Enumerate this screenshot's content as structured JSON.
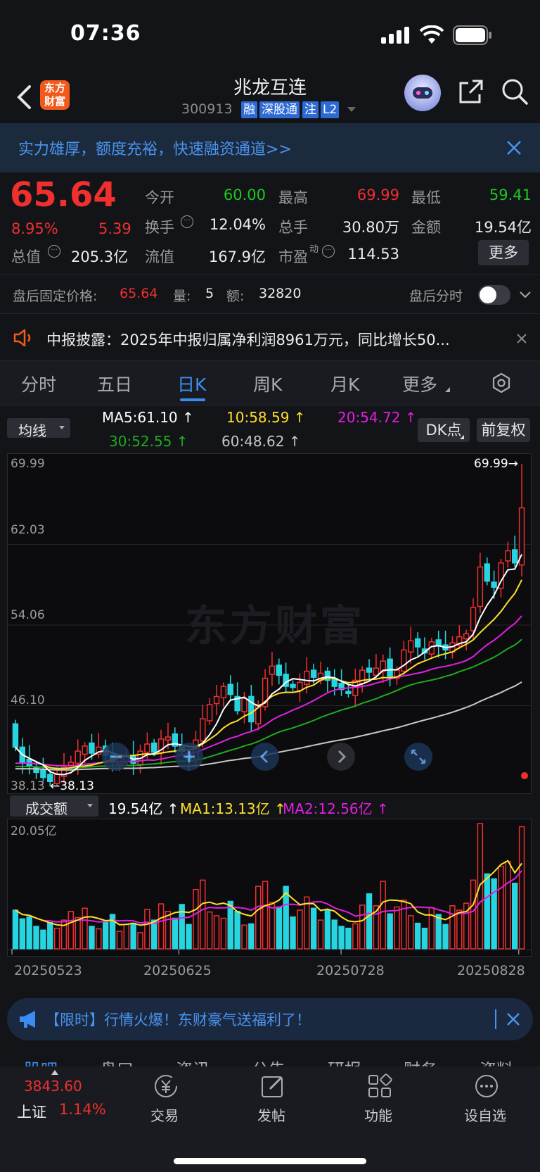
{
  "status": {
    "time": "07:36"
  },
  "header": {
    "logo_text": "东方财富",
    "stock_name": "兆龙互连",
    "stock_code": "300913",
    "tags": [
      "融",
      "深股通",
      "注",
      "L2"
    ]
  },
  "banner": {
    "text": "实力雄厚，额度充裕，快速融资通道>>"
  },
  "quote": {
    "price": "65.64",
    "change_pct": "8.95%",
    "change": "5.39",
    "open_label": "今开",
    "open": "60.00",
    "high_label": "最高",
    "high": "69.99",
    "low_label": "最低",
    "low": "59.41",
    "turnover_label": "换手",
    "turnover": "12.04%",
    "volume_label": "总手",
    "volume": "30.80万",
    "amount_label": "金额",
    "amount": "19.54亿",
    "mktcap_label": "总值",
    "mktcap": "205.3亿",
    "float_label": "流值",
    "float": "167.9亿",
    "pe_label": "市盈",
    "pe_sup": "动",
    "pe": "114.53",
    "more_label": "更多"
  },
  "afterhours": {
    "label": "盘后固定价格:",
    "price": "65.64",
    "vol_label": "量:",
    "vol": "5",
    "amt_label": "额:",
    "amt": "32820",
    "toggle_label": "盘后分时"
  },
  "notice": {
    "text": "中报披露：2025年中报归属净利润8961万元，同比增长50..."
  },
  "tabs": [
    "分时",
    "五日",
    "日K",
    "周K",
    "月K",
    "更多"
  ],
  "active_tab": "日K",
  "ma": {
    "selector": "均线",
    "ma5": "MA5:61.10",
    "ma10": "10:58.59",
    "ma20": "20:54.72",
    "ma30": "30:52.55",
    "ma60": "60:48.62",
    "dk_label": "DK点",
    "adjust_label": "前复权"
  },
  "chart_labels": {
    "y_ticks": [
      "69.99",
      "62.03",
      "54.06",
      "46.10",
      "38.13"
    ],
    "max_marker": "69.99→",
    "min_marker": "←38.13",
    "watermark": "东方财富"
  },
  "volume_header": {
    "selector": "成交额",
    "value": "19.54亿",
    "ma1": "MA1:13.13亿",
    "ma2": "MA2:12.56亿",
    "max_tick": "20.05亿"
  },
  "dates": [
    "20250523",
    "20250625",
    "20250728",
    "20250828"
  ],
  "promo": {
    "text": "【限时】行情火爆！东财豪气送福利了！"
  },
  "bottom_tabs": [
    "股吧",
    "盘口",
    "资讯",
    "公告",
    "研报",
    "财务",
    "资料"
  ],
  "bottombar": {
    "index_value": "3843.60",
    "index_name": "上证",
    "index_change": "1.14%",
    "items": [
      "交易",
      "发帖",
      "功能",
      "设自选"
    ]
  },
  "colors": {
    "up": "#f02f2f",
    "down": "#27d5e0",
    "ma5": "#ffffff",
    "ma10": "#ffe02a",
    "ma20": "#e020e0",
    "ma30": "#1faa1f",
    "ma60": "#c8c8c8",
    "accent": "#3b8cf2"
  },
  "chart_data": {
    "type": "candlestick",
    "ylim": [
      38.13,
      69.99
    ],
    "y_ticks": [
      69.99,
      62.03,
      54.06,
      46.1,
      38.13
    ],
    "x_ticks": [
      "20250523",
      "20250625",
      "20250728",
      "20250828"
    ],
    "high": 69.99,
    "low": 38.13,
    "last_close": 65.64,
    "ma": {
      "MA5": 61.1,
      "MA10": 58.59,
      "MA20": 54.72,
      "MA30": 52.55,
      "MA60": 48.62
    },
    "closes": [
      42.0,
      40.5,
      40.2,
      39.5,
      39.0,
      38.6,
      39.3,
      40.0,
      40.5,
      41.6,
      42.1,
      41.4,
      42.0,
      41.2,
      40.5,
      40.9,
      41.0,
      40.4,
      41.6,
      42.3,
      41.5,
      42.8,
      43.0,
      42.1,
      41.6,
      40.8,
      42.7,
      44.8,
      46.2,
      47.0,
      48.0,
      47.2,
      45.6,
      46.8,
      44.5,
      46.2,
      48.8,
      50.0,
      49.1,
      48.0,
      47.9,
      48.4,
      49.5,
      48.9,
      49.3,
      48.6,
      48.0,
      47.7,
      47.3,
      48.6,
      49.6,
      49.4,
      49.8,
      50.5,
      48.9,
      49.6,
      51.6,
      52.5,
      51.9,
      51.3,
      52.4,
      52.0,
      51.6,
      52.3,
      52.9,
      53.2,
      55.8,
      59.8,
      58.4,
      57.8,
      60.2,
      61.4,
      60.2,
      65.64
    ],
    "opens": [
      44.3,
      42.0,
      40.8,
      40.0,
      39.8,
      39.3,
      38.4,
      39.1,
      40.2,
      40.4,
      41.3,
      42.4,
      41.3,
      42.1,
      41.3,
      40.3,
      40.6,
      41.2,
      40.3,
      41.5,
      42.4,
      41.4,
      42.7,
      43.3,
      42.2,
      41.4,
      40.8,
      42.6,
      44.6,
      46.3,
      46.9,
      48.2,
      47.0,
      45.5,
      47.0,
      44.3,
      46.0,
      49.2,
      50.1,
      49.2,
      48.2,
      47.6,
      48.2,
      49.6,
      48.6,
      49.5,
      48.8,
      48.3,
      47.5,
      47.1,
      48.3,
      49.8,
      49.1,
      49.5,
      50.7,
      48.8,
      49.5,
      51.4,
      52.7,
      51.7,
      51.2,
      52.6,
      52.1,
      51.4,
      52.1,
      52.7,
      53.5,
      55.9,
      60.1,
      58.3,
      57.7,
      60.4,
      61.5,
      60.0
    ],
    "volumes_yi": [
      6.2,
      4.8,
      5.1,
      3.6,
      3.0,
      4.2,
      3.3,
      4.6,
      6.0,
      5.0,
      6.5,
      3.6,
      3.2,
      4.2,
      5.5,
      2.8,
      3.9,
      4.1,
      2.6,
      6.3,
      4.6,
      7.2,
      6.0,
      4.9,
      7.1,
      3.9,
      9.5,
      11.0,
      5.9,
      5.3,
      4.9,
      7.6,
      6.0,
      3.8,
      4.0,
      10.0,
      10.8,
      7.4,
      6.7,
      10.0,
      5.1,
      6.2,
      8.3,
      6.5,
      4.6,
      6.2,
      4.6,
      3.6,
      3.3,
      4.0,
      7.0,
      8.8,
      6.9,
      10.8,
      5.6,
      6.7,
      7.8,
      5.3,
      4.1,
      3.3,
      6.6,
      5.5,
      3.9,
      6.9,
      6.2,
      7.3,
      11.0,
      20.05,
      12.0,
      11.2,
      13.2,
      14.0,
      10.5,
      19.54
    ]
  }
}
